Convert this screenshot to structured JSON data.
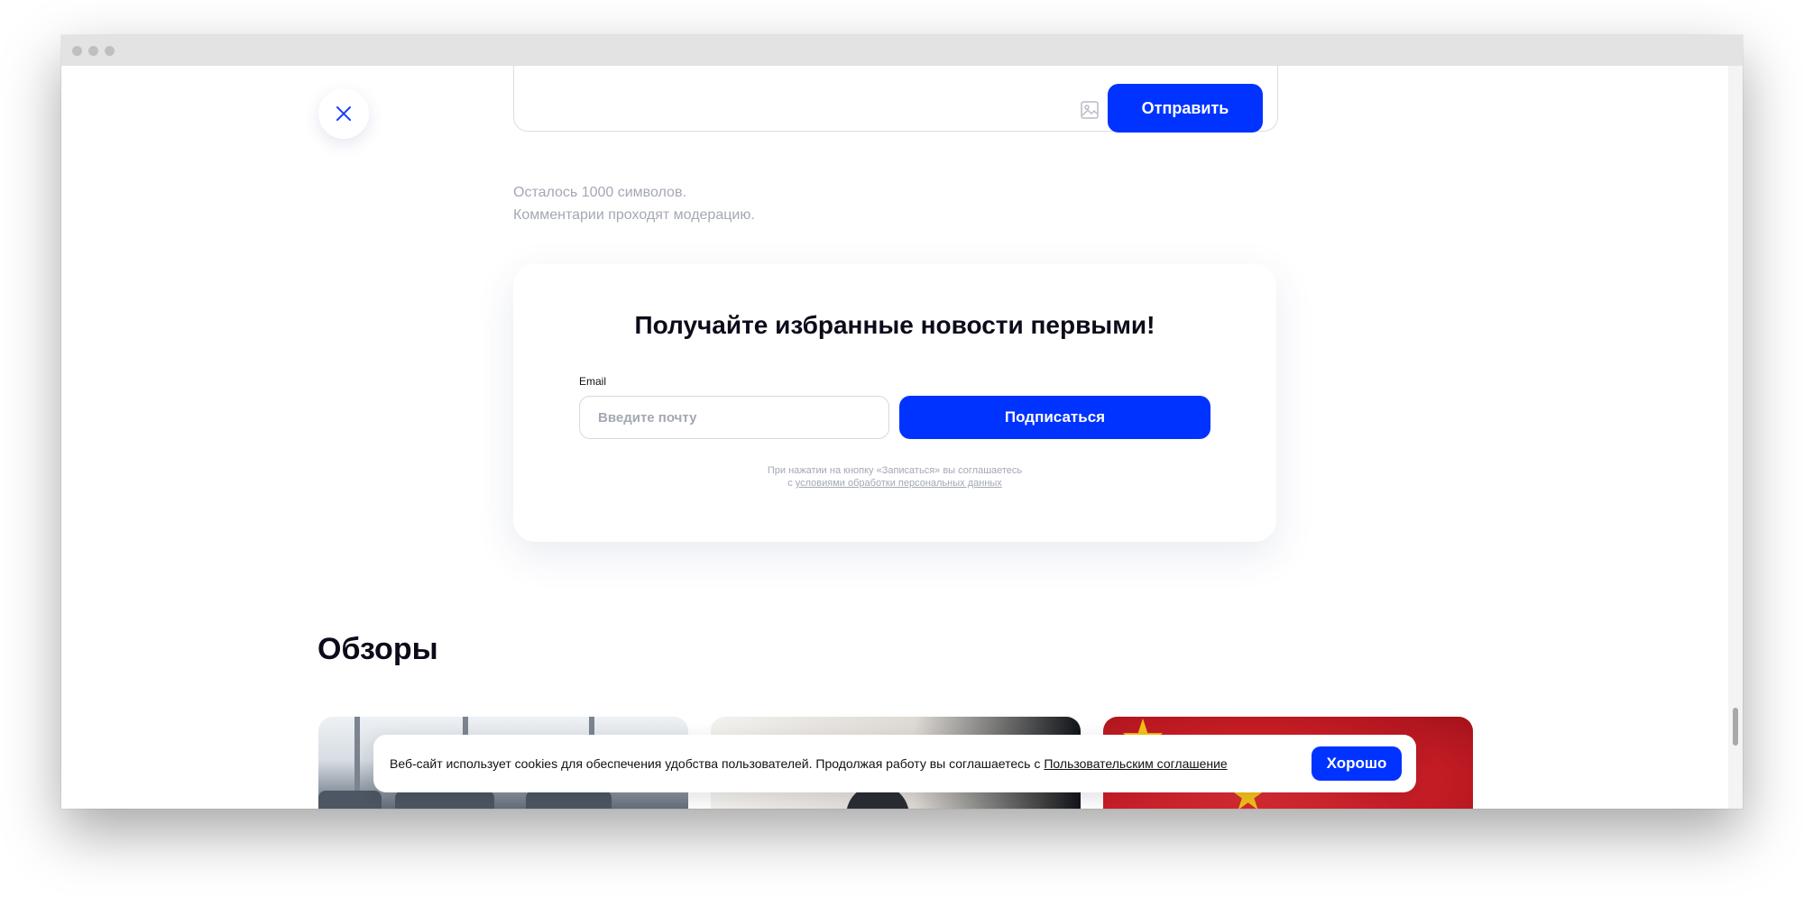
{
  "comment_form": {
    "send_label": "Отправить",
    "chars_left": "Осталось 1000 символов.",
    "moderation_note": "Комментарии проходят модерацию."
  },
  "subscribe": {
    "title": "Получайте избранные новости первыми!",
    "email_label": "Email",
    "email_placeholder": "Введите почту",
    "button_label": "Подписаться",
    "consent_line1": "При нажатии на кнопку «Записаться» вы соглашаетесь",
    "consent_prefix": "с",
    "consent_link": "условиями обработки персональных данных"
  },
  "reviews": {
    "title": "Обзоры"
  },
  "cookie_banner": {
    "text": "Веб-сайт использует cookies для обеспечения удобства пользователей. Продолжая работу вы соглашаетесь с",
    "link": "Пользовательским соглашение",
    "button_label": "Хорошо"
  },
  "colors": {
    "accent": "#0033ff",
    "muted_text": "#a3a8b4",
    "heading": "#0b0b1a"
  }
}
